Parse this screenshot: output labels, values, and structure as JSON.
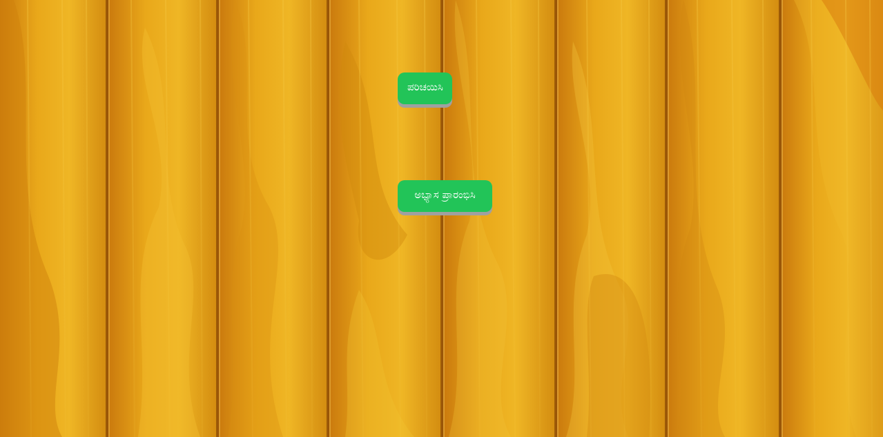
{
  "background": {
    "theme": "wood-planks",
    "base_color": "#e7a515",
    "dark_color": "#b8660a",
    "light_color": "#f2c232"
  },
  "menu": {
    "buttons": [
      {
        "label": "ಪರಿಚಯಿಸಿ",
        "color": "#22c458"
      },
      {
        "label": "ಅಭ್ಯಾಸ ಪ್ರಾರಂಭಿಸಿ",
        "color": "#22c458"
      }
    ]
  }
}
